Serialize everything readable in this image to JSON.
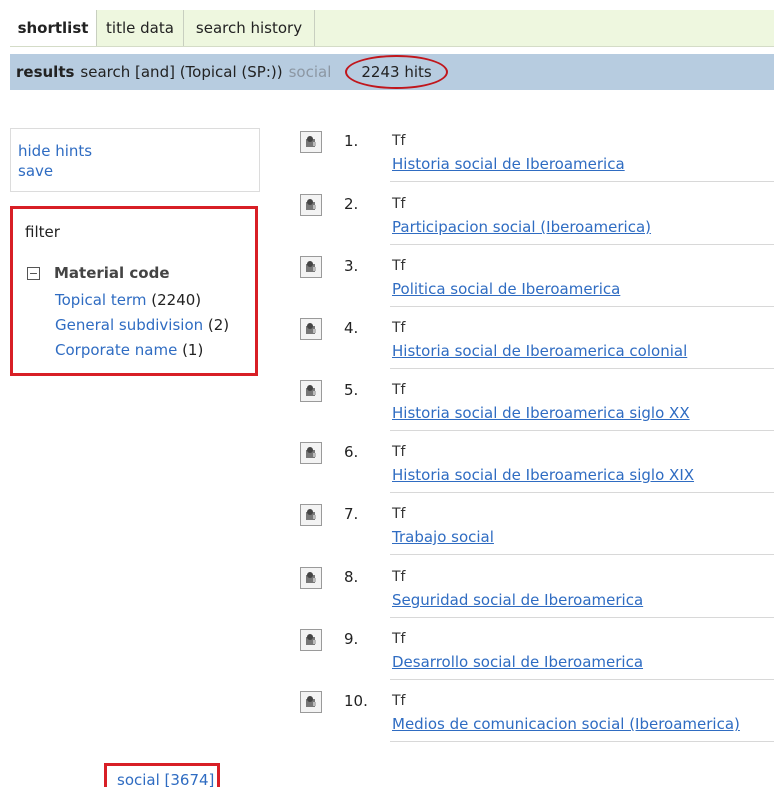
{
  "tabs": [
    {
      "label": "shortlist"
    },
    {
      "label": "title data"
    },
    {
      "label": "search history"
    }
  ],
  "results_bar": {
    "label": "results",
    "query": "search [and] (Topical (SP:))",
    "term": "social",
    "hits": "2243 hits"
  },
  "hints": {
    "hide_hints": "hide hints",
    "save": "save"
  },
  "filter": {
    "title": "filter",
    "facet_toggle": "⊟",
    "facet_title": "Material code",
    "items": [
      {
        "label": "Topical term",
        "count": "(2240)"
      },
      {
        "label": "General subdivision",
        "count": "(2)"
      },
      {
        "label": "Corporate name",
        "count": "(1)"
      }
    ]
  },
  "results": [
    {
      "num": "1.",
      "type": "Tf",
      "title": "Historia social de Iberoamerica"
    },
    {
      "num": "2.",
      "type": "Tf",
      "title": "Participacion social (Iberoamerica)"
    },
    {
      "num": "3.",
      "type": "Tf",
      "title": "Politica social de Iberoamerica"
    },
    {
      "num": "4.",
      "type": "Tf",
      "title": "Historia social de Iberoamerica colonial"
    },
    {
      "num": "5.",
      "type": "Tf",
      "title": "Historia social de Iberoamerica siglo XX"
    },
    {
      "num": "6.",
      "type": "Tf",
      "title": "Historia social de Iberoamerica siglo XIX"
    },
    {
      "num": "7.",
      "type": "Tf",
      "title": "Trabajo social"
    },
    {
      "num": "8.",
      "type": "Tf",
      "title": "Seguridad social de Iberoamerica"
    },
    {
      "num": "9.",
      "type": "Tf",
      "title": "Desarrollo social de Iberoamerica"
    },
    {
      "num": "10.",
      "type": "Tf",
      "title": "Medios de comunicacion social (Iberoamerica)"
    }
  ],
  "related_term": "social [3674]",
  "colors": {
    "link": "#2f6cc2",
    "tabbar_bg": "#eef7df",
    "results_bar_bg": "#b7cce0",
    "highlight_red": "#d81f26"
  },
  "icons": {
    "result_record": "record-icon",
    "facet_toggle": "collapse-icon"
  }
}
